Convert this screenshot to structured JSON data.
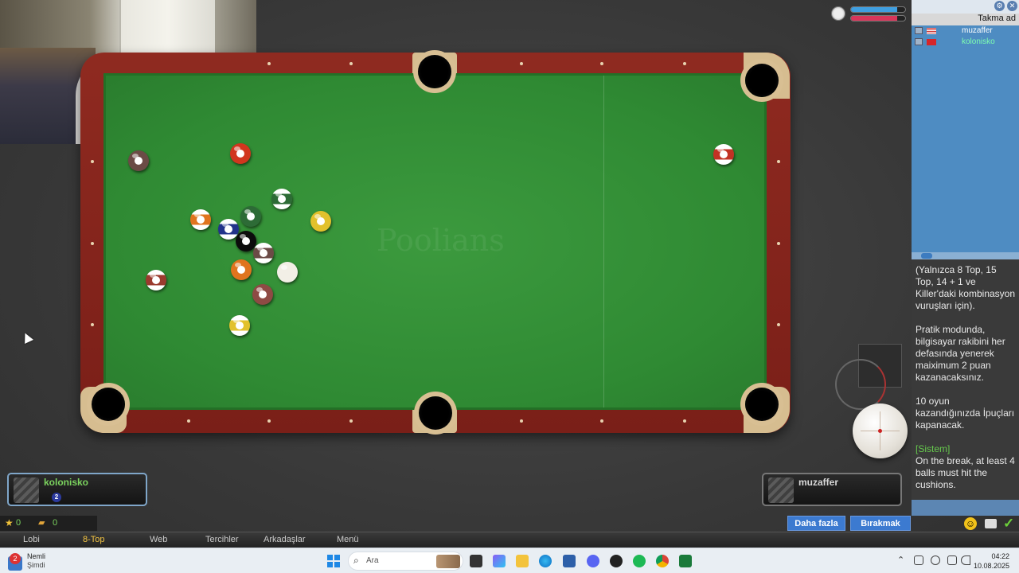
{
  "game": {
    "watermark": "Poolians",
    "mode_tab": "8-Top"
  },
  "players": {
    "left": {
      "name": "kolonisko",
      "ball_group": "2"
    },
    "right": {
      "name": "muzaffer"
    }
  },
  "sidebar": {
    "header": "Takma ad",
    "users": [
      {
        "name": "muzaffer",
        "flag": "us-flag-icon"
      },
      {
        "name": "kolonisko",
        "flag": "tr-flag-icon"
      }
    ],
    "chat": [
      "(Yalnızca 8 Top, 15 Top, 14 + 1 ve Killer'daki kombinasyon vuruşları için).",
      "Pratik modunda, bilgisayar rakibini her defasında yenerek maiximum 2 puan kazanacaksınız.",
      "10 oyun kazandığınızda İpuçları kapanacak."
    ],
    "system_tag": "[Sistem]",
    "system_msg": "On the break, at least 4 balls must hit the cushions."
  },
  "stats": {
    "stars": "0",
    "coins": "0"
  },
  "buttons": {
    "more": "Daha fazla",
    "quit": "Bırakmak"
  },
  "menu": [
    "Lobi",
    "8-Top",
    "Web",
    "Tercihler",
    "Arkadaşlar",
    "Menü"
  ],
  "taskbar": {
    "notif_count": "2",
    "notif_title": "Nemli",
    "notif_sub": "Şimdi",
    "search_placeholder": "Ara",
    "time": "04:22",
    "date": "10.08.2025"
  },
  "timers": {
    "player1_fill": 0.85,
    "player2_fill": 0.85
  },
  "colors": {
    "accent_blue": "#3c7ad0",
    "felt_green": "#2f8a33",
    "rail_red": "#8f2a20",
    "active_name": "#7bd35e"
  }
}
